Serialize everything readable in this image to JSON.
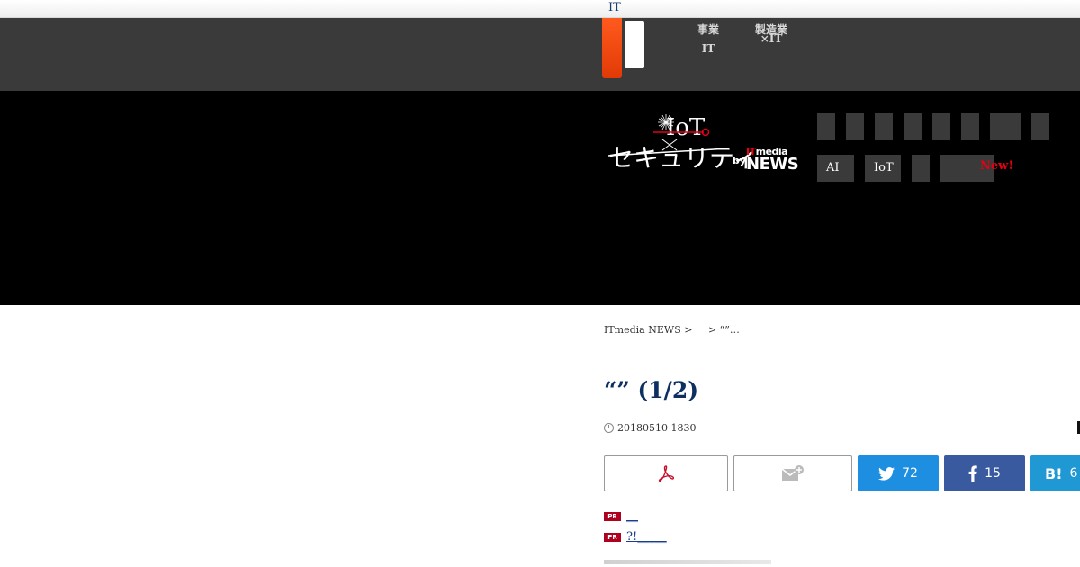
{
  "top_strip": {
    "label": "IT"
  },
  "header": {
    "links": [
      {
        "line1": "事業",
        "line2": "IT"
      },
      {
        "line1": "製造業",
        "line2": "×IT"
      }
    ]
  },
  "banner": {
    "logo_alt": "IoT セキュリティ by ITmedia NEWS",
    "logo_by": "by",
    "logo_itmedia_accent": "IT",
    "logo_itmedia": "media",
    "logo_news": "NEWS",
    "nav_row_2": [
      "AI",
      "IoT",
      "",
      ""
    ],
    "new_label": "New!"
  },
  "breadcrumb": {
    "home": "ITmedia NEWS >",
    "current": "> “”…"
  },
  "article": {
    "title": "“” (1/2)",
    "date": "20180510 1830"
  },
  "share": {
    "twitter_count": "72",
    "facebook_count": "15",
    "hatena_label": "B!",
    "hatena_count": "6"
  },
  "pr_links": [
    {
      "badge": "PR",
      "text": "__"
    },
    {
      "badge": "PR",
      "text": "?!_____"
    }
  ],
  "colors": {
    "orange_tab": "#ff5a1e",
    "title_navy": "#0d3060",
    "twitter_blue": "#1d8ee0",
    "facebook_blue": "#3a5a9f",
    "hatena_blue": "#1f98d4",
    "new_red": "#e60012"
  }
}
